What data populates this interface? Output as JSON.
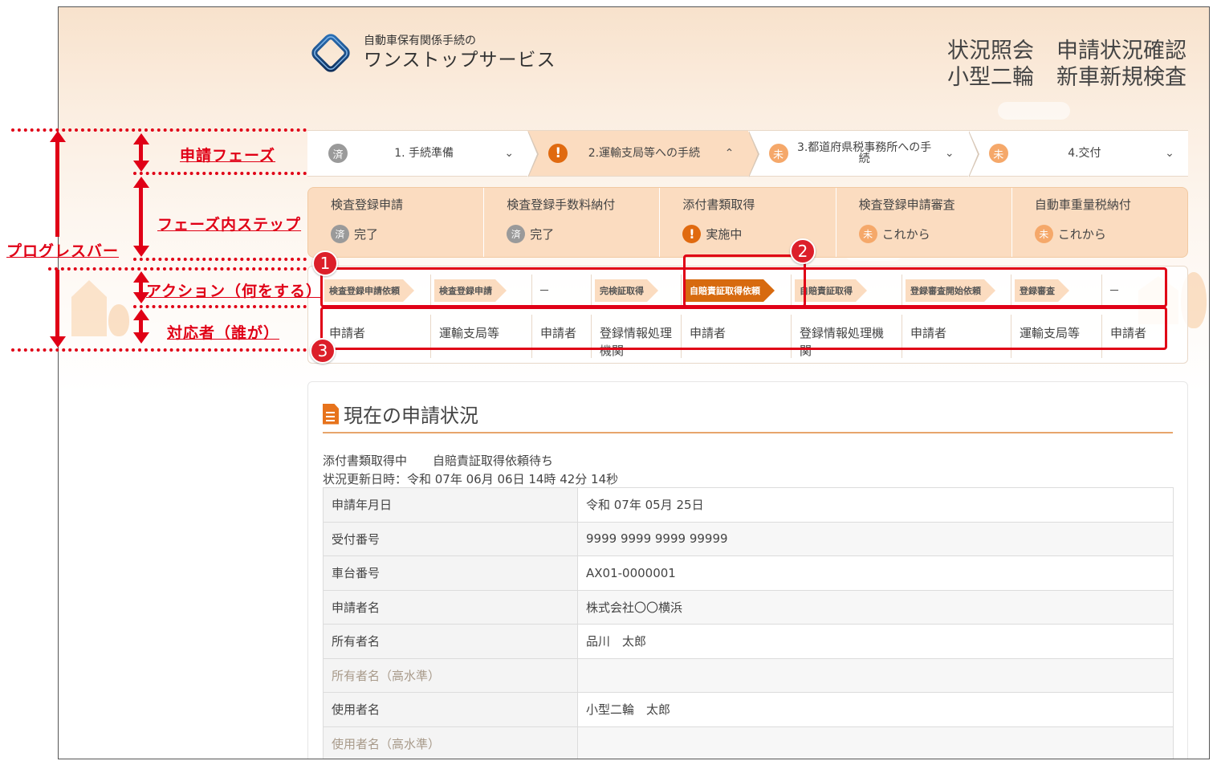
{
  "header": {
    "logo_sub": "自動車保有関係手続の",
    "logo_main": "ワンストップサービス",
    "title_lines": [
      [
        "状況照会",
        "申請状況確認"
      ],
      [
        "小型二輪",
        "新車新規検査"
      ]
    ]
  },
  "phases": [
    {
      "badge": "済",
      "state": "done",
      "label": "1. 手続準備",
      "chevron": "⌄"
    },
    {
      "badge": "!",
      "state": "alert",
      "label": "2.運輸支局等への手続",
      "chevron": "⌃"
    },
    {
      "badge": "未",
      "state": "todo",
      "label": "3.都道府県税事務所への手続",
      "chevron": "⌄"
    },
    {
      "badge": "未",
      "state": "todo",
      "label": "4.交付",
      "chevron": "⌄"
    }
  ],
  "steps": [
    {
      "name": "検査登録申請",
      "badge": "済",
      "state": "done",
      "status": "完了"
    },
    {
      "name": "検査登録手数料納付",
      "badge": "済",
      "state": "done",
      "status": "完了"
    },
    {
      "name": "添付書類取得",
      "badge": "!",
      "state": "alert",
      "status": "実施中"
    },
    {
      "name": "検査登録申請審査",
      "badge": "未",
      "state": "todo",
      "status": "これから"
    },
    {
      "name": "自動車重量税納付",
      "badge": "未",
      "state": "todo",
      "status": "これから"
    }
  ],
  "actions": [
    {
      "label": "検査登録申請依頼",
      "kind": "pill"
    },
    {
      "label": "検査登録申請",
      "kind": "pill"
    },
    {
      "label": "－",
      "kind": "dash"
    },
    {
      "label": "完検証取得",
      "kind": "pill"
    },
    {
      "label": "自賠責証取得依頼",
      "kind": "pill-on"
    },
    {
      "label": "自賠責証取得",
      "kind": "pill"
    },
    {
      "label": "登録審査開始依頼",
      "kind": "pill"
    },
    {
      "label": "登録審査",
      "kind": "pill"
    },
    {
      "label": "－",
      "kind": "dash"
    }
  ],
  "actors": [
    "申請者",
    "運輸支局等",
    "申請者",
    "登録情報処理機関",
    "申請者",
    "登録情報処理機関",
    "申請者",
    "運輸支局等",
    "申請者"
  ],
  "status": {
    "heading": "現在の申請状況",
    "state_phase": "添付書類取得中",
    "state_action": "自賠責証取得依頼待ち",
    "updated": "状況更新日時：令和 07年 06月 06日 14時 42分 14秒",
    "rows": [
      {
        "key": "申請年月日",
        "value": "令和 07年 05月 25日",
        "muted": false
      },
      {
        "key": "受付番号",
        "value": "9999 9999 9999 99999",
        "muted": false
      },
      {
        "key": "車台番号",
        "value": "AX01-0000001",
        "muted": false
      },
      {
        "key": "申請者名",
        "value": "株式会社〇〇横浜",
        "muted": false
      },
      {
        "key": "所有者名",
        "value": "品川　太郎",
        "muted": false
      },
      {
        "key": "所有者名（高水準）",
        "value": "",
        "muted": true
      },
      {
        "key": "使用者名",
        "value": "小型二輪　太郎",
        "muted": false
      },
      {
        "key": "使用者名（高水準）",
        "value": "",
        "muted": true
      }
    ]
  },
  "annotations": {
    "progress_bar": "プログレスバー",
    "phase": "申請フェーズ",
    "step": "フェーズ内ステップ",
    "action": "アクション（何をする）",
    "actor": "対応者（誰が）",
    "badges": [
      "1",
      "2",
      "3"
    ]
  },
  "colors": {
    "accent": "#d76a0f",
    "annotation": "#e00016",
    "phase_active_bg": "#fbdcc0",
    "badge_done": "#9a9a9a",
    "badge_todo": "#f5a86a"
  }
}
